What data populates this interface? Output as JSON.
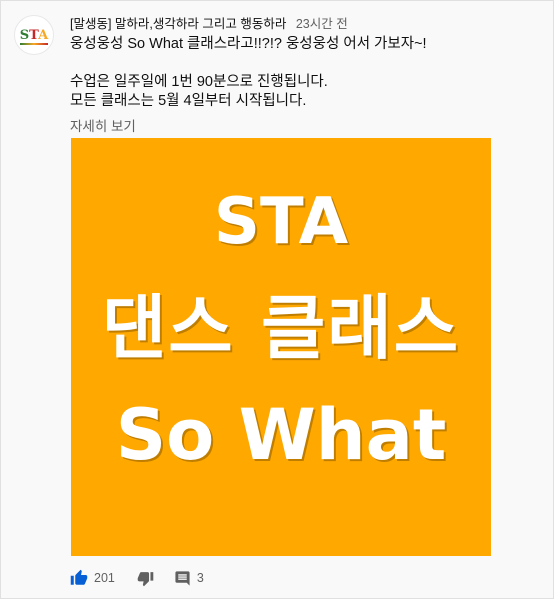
{
  "channel": {
    "name": "[말생동] 말하라,생각하라 그리고 행동하라",
    "time": "23시간 전",
    "avatar_text": "STA"
  },
  "post": {
    "line1": "웅성웅성 So What 클래스라고!!?!? 웅성웅성 어서 가보자~!",
    "line2": "수업은 일주일에 1번 90분으로 진행됩니다.",
    "line3": "모든 클래스는 5월 4일부터 시작됩니다.",
    "more_label": "자세히 보기"
  },
  "image": {
    "background": "#ffa800",
    "text_line1": "STA",
    "text_line2": "댄스 클래스",
    "text_line3": "So What"
  },
  "actions": {
    "like_icon": "thumb-up-icon",
    "like_count": "201",
    "dislike_icon": "thumb-down-icon",
    "comment_icon": "comment-icon",
    "comment_count": "3",
    "accent": "#065fd4"
  }
}
